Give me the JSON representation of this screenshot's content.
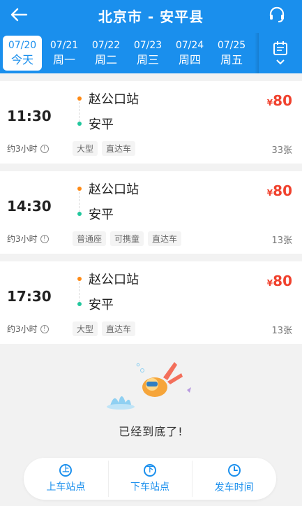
{
  "header": {
    "title": "北京市 - 安平县",
    "back_icon": "arrow-left-icon",
    "service_icon": "headset-icon",
    "calendar_icon": "calendar-icon"
  },
  "dates": [
    {
      "date": "07/20",
      "weekday": "今天",
      "active": true
    },
    {
      "date": "07/21",
      "weekday": "周一"
    },
    {
      "date": "07/22",
      "weekday": "周二"
    },
    {
      "date": "07/23",
      "weekday": "周三"
    },
    {
      "date": "07/24",
      "weekday": "周四"
    },
    {
      "date": "07/25",
      "weekday": "周五"
    }
  ],
  "trips": [
    {
      "time": "11:30",
      "from": "赵公口站",
      "to": "安平",
      "price_symbol": "¥",
      "price": "80",
      "duration": "约3小时",
      "tags": [
        "大型",
        "直达车"
      ],
      "seats": "33张"
    },
    {
      "time": "14:30",
      "from": "赵公口站",
      "to": "安平",
      "price_symbol": "¥",
      "price": "80",
      "duration": "约3小时",
      "tags": [
        "普通座",
        "可携童",
        "直达车"
      ],
      "seats": "13张"
    },
    {
      "time": "17:30",
      "from": "赵公口站",
      "to": "安平",
      "price_symbol": "¥",
      "price": "80",
      "duration": "约3小时",
      "tags": [
        "大型",
        "直达车"
      ],
      "seats": "13张"
    }
  ],
  "end_text": "已经到底了!",
  "filters": [
    {
      "label": "上车站点",
      "icon_char": "上",
      "icon": "boarding-stop-icon"
    },
    {
      "label": "下车站点",
      "icon_char": "下",
      "icon": "alighting-stop-icon"
    },
    {
      "label": "发车时间",
      "icon_char": "",
      "icon": "clock-icon"
    }
  ],
  "colors": {
    "primary": "#1a8fed",
    "price": "#f0412d",
    "from_dot": "#ff8a14",
    "to_dot": "#21c79d"
  }
}
